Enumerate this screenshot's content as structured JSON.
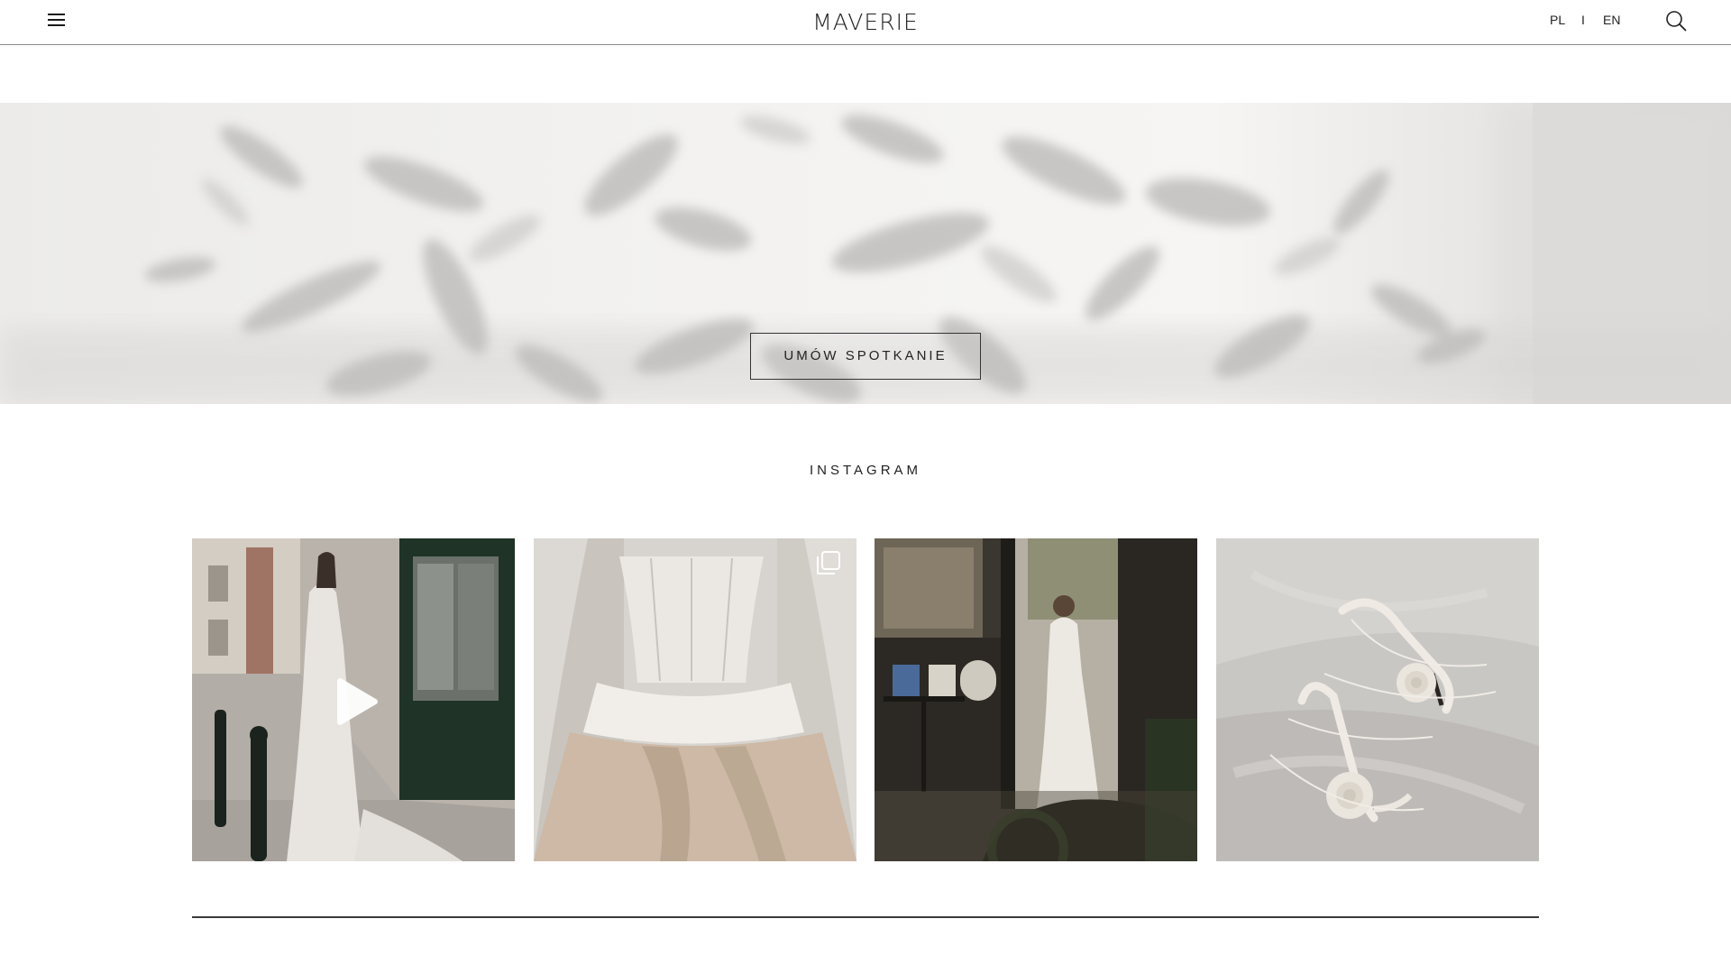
{
  "header": {
    "logo_text": "MAVERIE",
    "lang_pl": "PL",
    "lang_separator": "I",
    "lang_en": "EN",
    "menu_icon": "hamburger-menu-icon",
    "search_icon": "search-icon"
  },
  "hero": {
    "cta_label": "UMÓW SPOTKANIE"
  },
  "instagram": {
    "title": "INSTAGRAM",
    "posts": [
      {
        "type": "video",
        "overlay_icon": "play-icon"
      },
      {
        "type": "carousel",
        "overlay_icon": "multiple-images-icon"
      },
      {
        "type": "image"
      },
      {
        "type": "image"
      }
    ]
  },
  "colors": {
    "text": "#1a1a1a",
    "border": "#8a8a8a",
    "background": "#ffffff"
  }
}
